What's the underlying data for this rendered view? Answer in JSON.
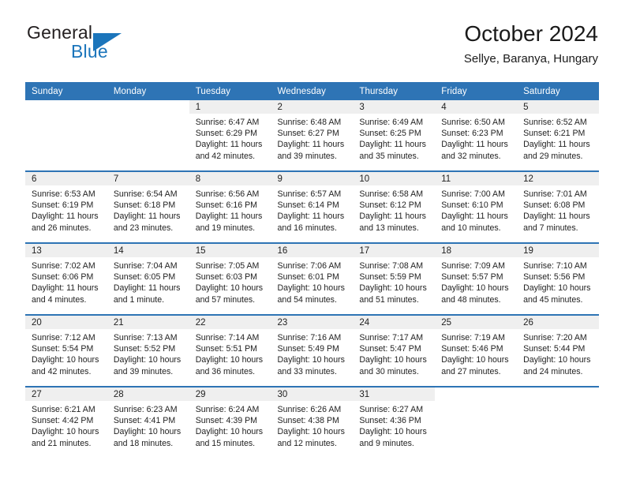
{
  "brand": {
    "name_top": "General",
    "name_bottom": "Blue",
    "accent_color": "#1b75bb"
  },
  "header": {
    "title": "October 2024",
    "subtitle": "Sellye, Baranya, Hungary"
  },
  "theme": {
    "header_blue": "#2e74b5",
    "daynum_band": "#efefef",
    "text": "#222222"
  },
  "weekday_headers": [
    "Sunday",
    "Monday",
    "Tuesday",
    "Wednesday",
    "Thursday",
    "Friday",
    "Saturday"
  ],
  "labels": {
    "sunrise_prefix": "Sunrise:",
    "sunset_prefix": "Sunset:",
    "daylight_prefix": "Daylight:"
  },
  "weeks": [
    [
      {
        "day": "",
        "lines": []
      },
      {
        "day": "",
        "lines": []
      },
      {
        "day": "1",
        "lines": [
          "Sunrise: 6:47 AM",
          "Sunset: 6:29 PM",
          "Daylight: 11 hours",
          "and 42 minutes."
        ]
      },
      {
        "day": "2",
        "lines": [
          "Sunrise: 6:48 AM",
          "Sunset: 6:27 PM",
          "Daylight: 11 hours",
          "and 39 minutes."
        ]
      },
      {
        "day": "3",
        "lines": [
          "Sunrise: 6:49 AM",
          "Sunset: 6:25 PM",
          "Daylight: 11 hours",
          "and 35 minutes."
        ]
      },
      {
        "day": "4",
        "lines": [
          "Sunrise: 6:50 AM",
          "Sunset: 6:23 PM",
          "Daylight: 11 hours",
          "and 32 minutes."
        ]
      },
      {
        "day": "5",
        "lines": [
          "Sunrise: 6:52 AM",
          "Sunset: 6:21 PM",
          "Daylight: 11 hours",
          "and 29 minutes."
        ]
      }
    ],
    [
      {
        "day": "6",
        "lines": [
          "Sunrise: 6:53 AM",
          "Sunset: 6:19 PM",
          "Daylight: 11 hours",
          "and 26 minutes."
        ]
      },
      {
        "day": "7",
        "lines": [
          "Sunrise: 6:54 AM",
          "Sunset: 6:18 PM",
          "Daylight: 11 hours",
          "and 23 minutes."
        ]
      },
      {
        "day": "8",
        "lines": [
          "Sunrise: 6:56 AM",
          "Sunset: 6:16 PM",
          "Daylight: 11 hours",
          "and 19 minutes."
        ]
      },
      {
        "day": "9",
        "lines": [
          "Sunrise: 6:57 AM",
          "Sunset: 6:14 PM",
          "Daylight: 11 hours",
          "and 16 minutes."
        ]
      },
      {
        "day": "10",
        "lines": [
          "Sunrise: 6:58 AM",
          "Sunset: 6:12 PM",
          "Daylight: 11 hours",
          "and 13 minutes."
        ]
      },
      {
        "day": "11",
        "lines": [
          "Sunrise: 7:00 AM",
          "Sunset: 6:10 PM",
          "Daylight: 11 hours",
          "and 10 minutes."
        ]
      },
      {
        "day": "12",
        "lines": [
          "Sunrise: 7:01 AM",
          "Sunset: 6:08 PM",
          "Daylight: 11 hours",
          "and 7 minutes."
        ]
      }
    ],
    [
      {
        "day": "13",
        "lines": [
          "Sunrise: 7:02 AM",
          "Sunset: 6:06 PM",
          "Daylight: 11 hours",
          "and 4 minutes."
        ]
      },
      {
        "day": "14",
        "lines": [
          "Sunrise: 7:04 AM",
          "Sunset: 6:05 PM",
          "Daylight: 11 hours",
          "and 1 minute."
        ]
      },
      {
        "day": "15",
        "lines": [
          "Sunrise: 7:05 AM",
          "Sunset: 6:03 PM",
          "Daylight: 10 hours",
          "and 57 minutes."
        ]
      },
      {
        "day": "16",
        "lines": [
          "Sunrise: 7:06 AM",
          "Sunset: 6:01 PM",
          "Daylight: 10 hours",
          "and 54 minutes."
        ]
      },
      {
        "day": "17",
        "lines": [
          "Sunrise: 7:08 AM",
          "Sunset: 5:59 PM",
          "Daylight: 10 hours",
          "and 51 minutes."
        ]
      },
      {
        "day": "18",
        "lines": [
          "Sunrise: 7:09 AM",
          "Sunset: 5:57 PM",
          "Daylight: 10 hours",
          "and 48 minutes."
        ]
      },
      {
        "day": "19",
        "lines": [
          "Sunrise: 7:10 AM",
          "Sunset: 5:56 PM",
          "Daylight: 10 hours",
          "and 45 minutes."
        ]
      }
    ],
    [
      {
        "day": "20",
        "lines": [
          "Sunrise: 7:12 AM",
          "Sunset: 5:54 PM",
          "Daylight: 10 hours",
          "and 42 minutes."
        ]
      },
      {
        "day": "21",
        "lines": [
          "Sunrise: 7:13 AM",
          "Sunset: 5:52 PM",
          "Daylight: 10 hours",
          "and 39 minutes."
        ]
      },
      {
        "day": "22",
        "lines": [
          "Sunrise: 7:14 AM",
          "Sunset: 5:51 PM",
          "Daylight: 10 hours",
          "and 36 minutes."
        ]
      },
      {
        "day": "23",
        "lines": [
          "Sunrise: 7:16 AM",
          "Sunset: 5:49 PM",
          "Daylight: 10 hours",
          "and 33 minutes."
        ]
      },
      {
        "day": "24",
        "lines": [
          "Sunrise: 7:17 AM",
          "Sunset: 5:47 PM",
          "Daylight: 10 hours",
          "and 30 minutes."
        ]
      },
      {
        "day": "25",
        "lines": [
          "Sunrise: 7:19 AM",
          "Sunset: 5:46 PM",
          "Daylight: 10 hours",
          "and 27 minutes."
        ]
      },
      {
        "day": "26",
        "lines": [
          "Sunrise: 7:20 AM",
          "Sunset: 5:44 PM",
          "Daylight: 10 hours",
          "and 24 minutes."
        ]
      }
    ],
    [
      {
        "day": "27",
        "lines": [
          "Sunrise: 6:21 AM",
          "Sunset: 4:42 PM",
          "Daylight: 10 hours",
          "and 21 minutes."
        ]
      },
      {
        "day": "28",
        "lines": [
          "Sunrise: 6:23 AM",
          "Sunset: 4:41 PM",
          "Daylight: 10 hours",
          "and 18 minutes."
        ]
      },
      {
        "day": "29",
        "lines": [
          "Sunrise: 6:24 AM",
          "Sunset: 4:39 PM",
          "Daylight: 10 hours",
          "and 15 minutes."
        ]
      },
      {
        "day": "30",
        "lines": [
          "Sunrise: 6:26 AM",
          "Sunset: 4:38 PM",
          "Daylight: 10 hours",
          "and 12 minutes."
        ]
      },
      {
        "day": "31",
        "lines": [
          "Sunrise: 6:27 AM",
          "Sunset: 4:36 PM",
          "Daylight: 10 hours",
          "and 9 minutes."
        ]
      },
      {
        "day": "",
        "lines": []
      },
      {
        "day": "",
        "lines": []
      }
    ]
  ]
}
